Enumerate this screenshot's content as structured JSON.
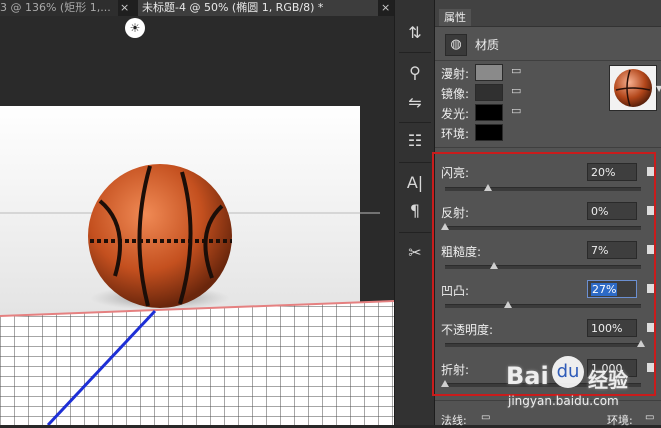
{
  "tabs": [
    {
      "label": "3 @ 136% (矩形 1,..."
    },
    {
      "label": "未标题-4 @ 50% (椭圆 1, RGB/8) *"
    }
  ],
  "tab_close": "×",
  "light_icon": "☀",
  "toolstrip": {
    "icons": [
      "3d-mesh-icon",
      "3d-environment-icon",
      "3d-light-icon",
      "layer-stack-icon",
      "character-icon",
      "paragraph-icon",
      "tools-icon"
    ],
    "glyphs": [
      "⇅",
      "⚲",
      "⇋",
      "☷",
      "A|",
      "¶",
      "✂"
    ]
  },
  "panel": {
    "tab_label": "属性",
    "title": "材质",
    "title_icon_glyph": "◍",
    "colors": [
      {
        "label": "漫射:",
        "swatch": "#8a8a8a"
      },
      {
        "label": "镜像:",
        "swatch": "#303030"
      },
      {
        "label": "发光:",
        "swatch": "#000000"
      },
      {
        "label": "环境:",
        "swatch": "#000000"
      }
    ],
    "folder_glyph": "▭",
    "sliders": [
      {
        "label": "闪亮:",
        "value": "20%",
        "fraction": 0.22
      },
      {
        "label": "反射:",
        "value": "0%",
        "fraction": 0.0
      },
      {
        "label": "粗糙度:",
        "value": "7%",
        "fraction": 0.25
      },
      {
        "label": "凹凸:",
        "value": "27%",
        "fraction": 0.32,
        "selected": true
      },
      {
        "label": "不透明度:",
        "value": "100%",
        "fraction": 1.0
      },
      {
        "label": "折射:",
        "value": "1.000",
        "fraction": 0.0
      }
    ],
    "footer_left": "法线:",
    "footer_right": "环境:"
  },
  "watermark": {
    "brand": "Bai",
    "paw": "du",
    "cn": "经验",
    "url": "jingyan.baidu.com"
  }
}
